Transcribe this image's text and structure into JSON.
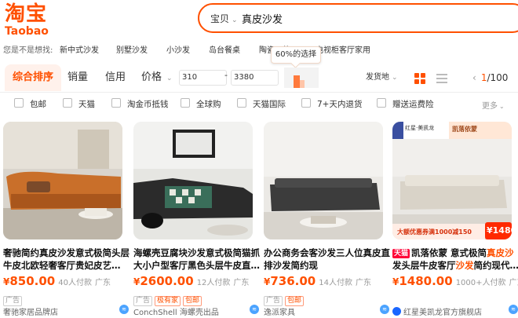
{
  "logo": {
    "cn": "淘宝",
    "en": "Taobao"
  },
  "search": {
    "scope": "宝贝",
    "query": "真皮沙发"
  },
  "suggestions": {
    "label": "您是不是想找:",
    "items": [
      "新中式沙发",
      "别墅沙发",
      "小沙发",
      "岛台餐桌",
      "陶瓷一体",
      "电视柜客厅家用"
    ],
    "tooltip": "60%的选择"
  },
  "sort": {
    "tabs": [
      "综合排序",
      "销量",
      "信用",
      "价格"
    ],
    "price_min": "310",
    "price_max": "3380",
    "price_sep": "-",
    "ship_from": "发货地",
    "page": "1",
    "total_pages": "/100"
  },
  "filters": [
    "包邮",
    "天猫",
    "淘金币抵钱",
    "全球购",
    "天猫国际",
    "7+天内退货",
    "赠送运费险"
  ],
  "filters_more": "更多",
  "products": [
    {
      "title_pre": "奢驰简约真皮沙发意式极简头层牛皮北欧轻奢客厅贵妃皮艺…",
      "title_hl": "",
      "title_post": "",
      "tmall": "",
      "price": "850.00",
      "sales": "40人付款",
      "loc": "广东",
      "tags": [
        "广告"
      ],
      "shop": "奢驰家居品牌店"
    },
    {
      "title_pre": "海螺壳豆腐块沙发意式极简猫抓大小户型客厅黑色头层牛皮直…",
      "title_hl": "",
      "title_post": "",
      "tmall": "",
      "price": "2600.00",
      "sales": "12人付款",
      "loc": "广东",
      "tags": [
        "广告",
        "极有家",
        "包邮"
      ],
      "shop": "ConchShell 海螺壳出品"
    },
    {
      "title_pre": "办公商务会客沙发三人位真皮直排沙发简约现",
      "title_hl": "",
      "title_post": "",
      "tmall": "",
      "price": "736.00",
      "sales": "14人付款",
      "loc": "广东",
      "tags": [
        "广告",
        "包邮"
      ],
      "shop": "逸派家具"
    },
    {
      "title_pre": "凯落依蒙 意式极简",
      "title_hl": "真皮沙",
      "title_post": "发头层牛皮客厅",
      "title_hl2": "沙发",
      "title_post2": "简约现代…",
      "tmall": "天猫",
      "price": "1480.00",
      "sales": "1000+人付款",
      "loc": "广东",
      "tags": [],
      "shop": "红星美凯龙官方旗舰店",
      "promo_price": "1480",
      "promo_text": "大额优惠券满1000减150",
      "promo_head": "红星·美凯龙",
      "promo_brand": "凯落依蒙"
    }
  ],
  "colors": {
    "accent": "#ff5000",
    "tmall": "#ff0036"
  }
}
